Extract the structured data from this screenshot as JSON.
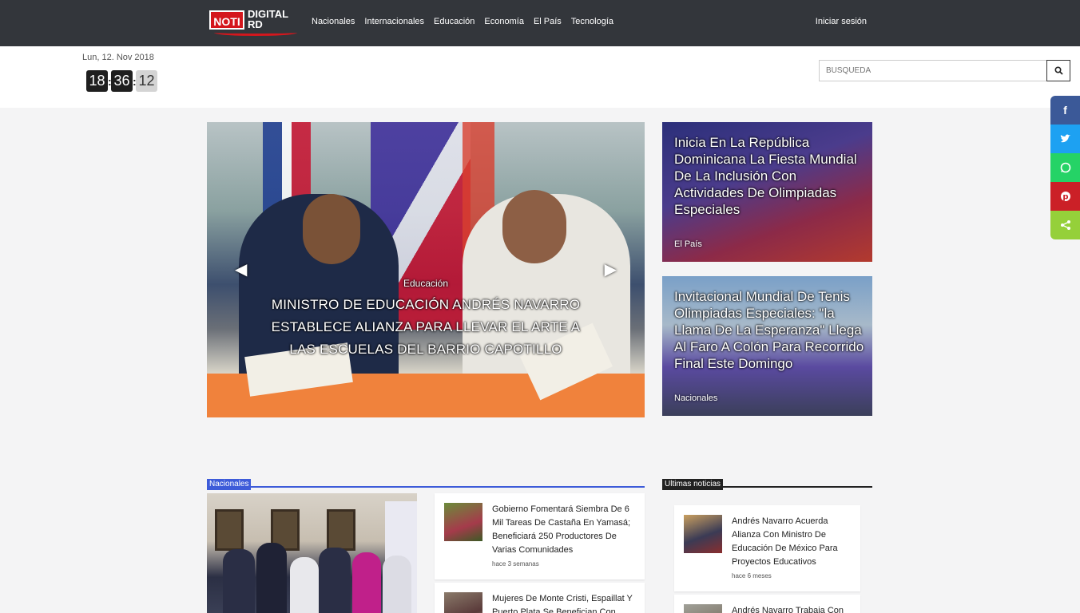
{
  "navbar": {
    "logo_top": "NOTI",
    "logo_digital": "DIGITAL",
    "logo_rd": "RD",
    "links": [
      "Nacionales",
      "Internacionales",
      "Educación",
      "Economía",
      "El País",
      "Tecnología"
    ],
    "login": "Iniciar sesión"
  },
  "header": {
    "date": "Lun, 12. Nov 2018",
    "clock": {
      "hours": "18",
      "minutes": "36",
      "seconds": "12"
    },
    "search_placeholder": "BUSQUEDA"
  },
  "share": [
    "facebook",
    "twitter",
    "whatsapp",
    "pinterest",
    "share"
  ],
  "hero": {
    "category": "Educación",
    "title": "MINISTRO DE EDUCACIÓN ANDRÉS NAVARRO ESTABLECE ALIANZA PARA LLEVAR EL ARTE A LAS ESCUELAS DEL BARRIO CAPOTILLO"
  },
  "side_cards": [
    {
      "title": "Inicia En La República Dominicana La Fiesta Mundial De La Inclusión Con Actividades De Olimpiadas Especiales",
      "category": "El País"
    },
    {
      "title": "Invitacional Mundial De Tenis Olimpiadas Especiales: \"la Llama De La Esperanza\" Llega Al Faro A Colón Para Recorrido Final Este Domingo",
      "category": "Nacionales"
    }
  ],
  "sections": {
    "nacionales": {
      "label": "Nacionales",
      "items": [
        {
          "title": "Gobierno Fomentará Siembra De 6 Mil Tareas De Castaña En Yamasá; Beneficiará 250 Productores De Varias Comunidades",
          "time": "hace 3 semanas"
        },
        {
          "title": "Mujeres De Monte Cristi, Espaillat Y Puerto Plata Se Benefician Con"
        }
      ]
    },
    "ultimas": {
      "label": "Ultimas noticias",
      "items": [
        {
          "title": "Andrés Navarro Acuerda Alianza Con Ministro De Educación De México Para Proyectos Educativos",
          "time": "hace 6 meses"
        },
        {
          "title": "Andrés Navarro Trabaja Con"
        }
      ]
    }
  },
  "colors": {
    "navbar": "#33363b",
    "brand_red": "#d4171d",
    "nacionales_accent": "#3d5bd9"
  }
}
